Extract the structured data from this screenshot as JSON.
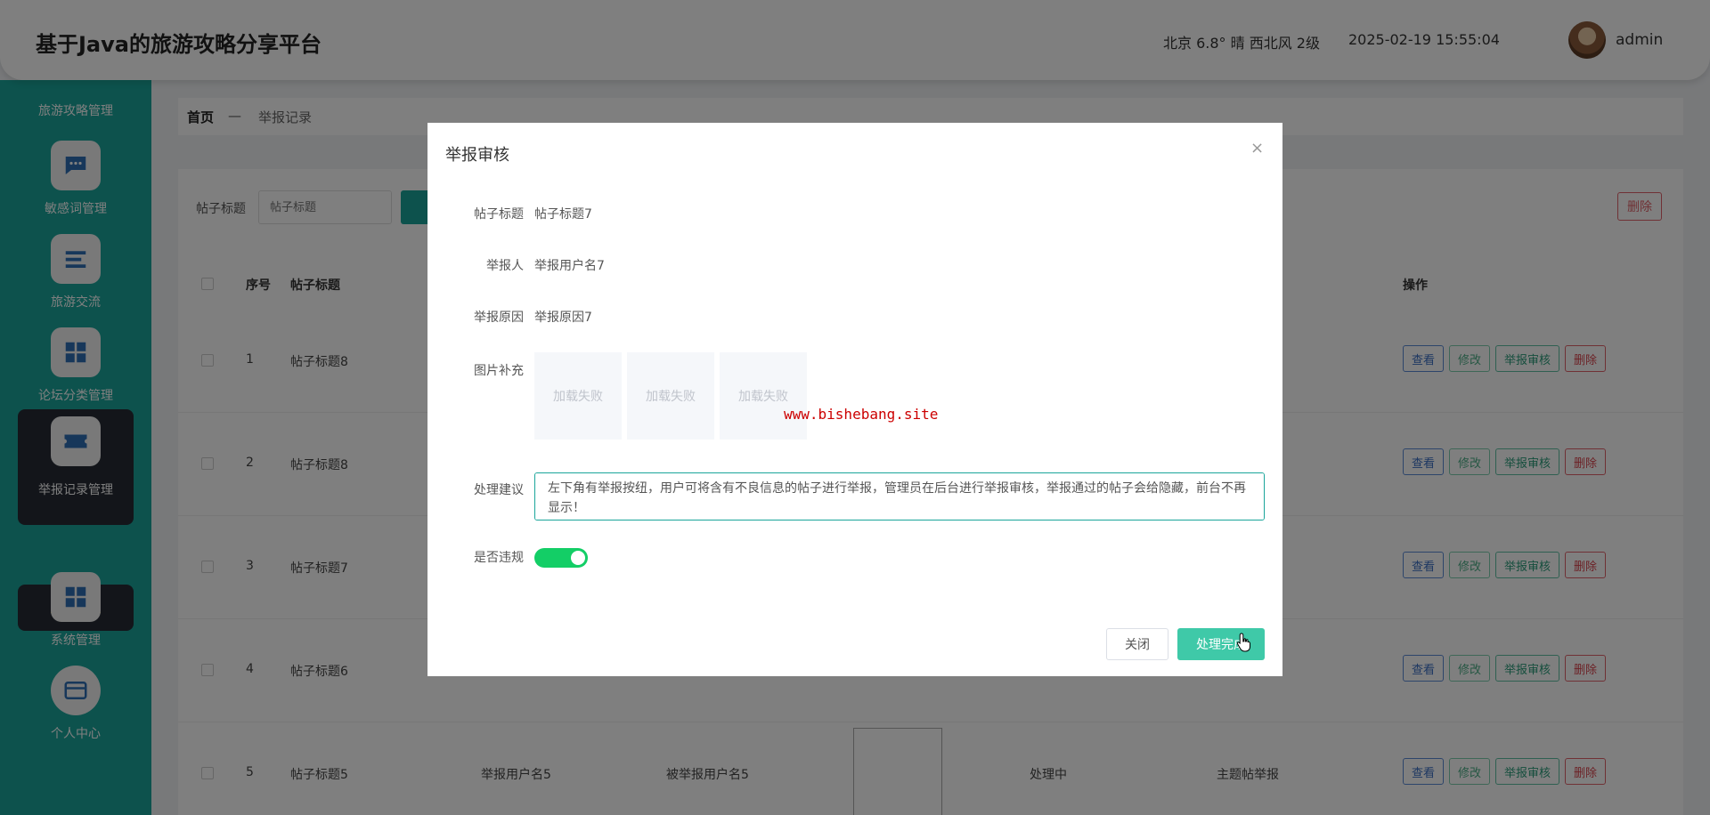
{
  "header": {
    "title": "基于Java的旅游攻略分享平台",
    "weather": "北京  6.8°  晴  西北风  2级",
    "datetime": "2025-02-19 15:55:04",
    "username": "admin"
  },
  "sidebar": {
    "top_label": "旅游攻略管理",
    "items": [
      {
        "label": "敏感词管理",
        "icon": "chat-icon"
      },
      {
        "label": "旅游交流",
        "icon": "list-icon"
      },
      {
        "label": "论坛分类管理",
        "icon": "grid-icon"
      },
      {
        "label": "举报记录管理",
        "icon": "ticket-icon"
      },
      {
        "label": "系统管理",
        "icon": "grid-icon"
      },
      {
        "label": "个人中心",
        "icon": "card-icon"
      }
    ],
    "sub_item": "举报记录"
  },
  "breadcrumb": {
    "home": "首页",
    "separator": "—",
    "current": "举报记录"
  },
  "toolbar": {
    "search_label": "帖子标题",
    "search_placeholder": "帖子标题",
    "delete_label": "删除"
  },
  "table": {
    "headers": {
      "index": "序号",
      "post_title": "帖子标题",
      "actions": "操作"
    },
    "rows": [
      {
        "index": "1",
        "title": "帖子标题8",
        "reporter": "",
        "reported": "",
        "status": "",
        "type": ""
      },
      {
        "index": "2",
        "title": "帖子标题8",
        "reporter": "",
        "reported": "",
        "status": "",
        "type": ""
      },
      {
        "index": "3",
        "title": "帖子标题7",
        "reporter": "",
        "reported": "",
        "status": "",
        "type": ""
      },
      {
        "index": "4",
        "title": "帖子标题6",
        "reporter": "",
        "reported": "",
        "status": "",
        "type": ""
      },
      {
        "index": "5",
        "title": "帖子标题5",
        "reporter": "举报用户名5",
        "reported": "被举报用户名5",
        "status": "处理中",
        "type": "主题帖举报"
      }
    ],
    "actions": {
      "view": "查看",
      "edit": "修改",
      "audit": "举报审核",
      "delete": "删除"
    }
  },
  "dialog": {
    "title": "举报审核",
    "close_icon": "×",
    "fields": {
      "post_title_label": "帖子标题",
      "post_title_value": "帖子标题7",
      "reporter_label": "举报人",
      "reporter_value": "举报用户名7",
      "reason_label": "举报原因",
      "reason_value": "举报原因7",
      "images_label": "图片补充",
      "image_placeholder": "加载失败",
      "suggestion_label": "处理建议",
      "suggestion_value": "左下角有举报按纽，用户可将含有不良信息的帖子进行举报，管理员在后台进行举报审核，举报通过的帖子会给隐藏，前台不再显示！",
      "violation_label": "是否违规",
      "violation_on": true
    },
    "buttons": {
      "close": "关闭",
      "done": "处理完成"
    },
    "watermark": "www.bishebang.site"
  },
  "colors": {
    "accent": "#1aa59a",
    "toggle_on": "#13ce66",
    "primary_button": "#3fc9a8",
    "danger": "#e0636b"
  }
}
